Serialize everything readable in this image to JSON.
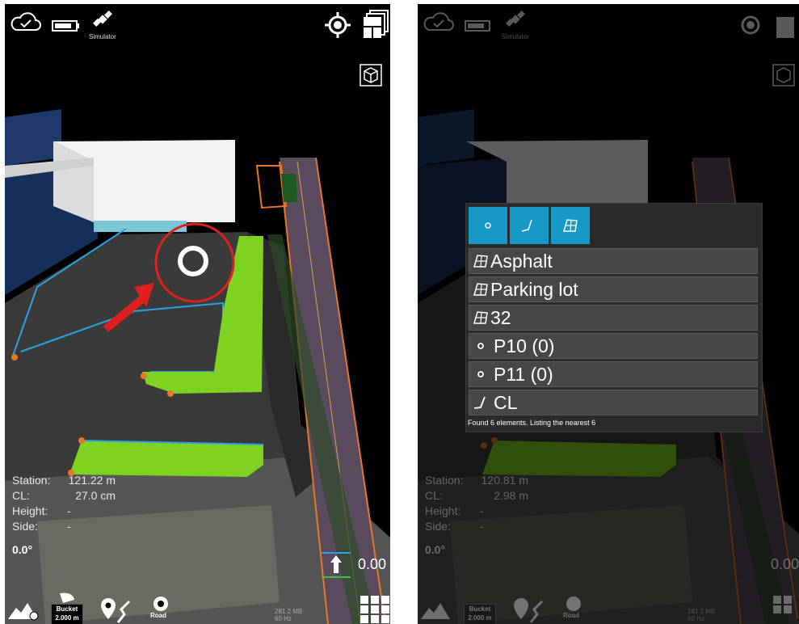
{
  "left_screen": {
    "topbar": {
      "simulator_label": "Simulator"
    },
    "info": [
      {
        "label": "Station:",
        "value": "121.22 m"
      },
      {
        "label": "CL:",
        "value": "27.0 cm"
      },
      {
        "label": "Height:",
        "value": "-"
      },
      {
        "label": "Side:",
        "value": "-"
      }
    ],
    "angle": "0.0°",
    "distance": "0.00",
    "bucket": {
      "title": "Bucket",
      "size": "2.000 m"
    },
    "road_label": "Road",
    "memory": [
      "281.2 MB",
      "60 Hz"
    ]
  },
  "right_screen": {
    "topbar": {
      "simulator_label": "Simulator"
    },
    "info": [
      {
        "label": "Station:",
        "value": "120.81 m"
      },
      {
        "label": "CL:",
        "value": "2.98 m"
      },
      {
        "label": "Height:",
        "value": "-"
      },
      {
        "label": "Side:",
        "value": "-"
      }
    ],
    "angle": "0.0°",
    "distance": "0.00",
    "bucket": {
      "title": "Bucket",
      "size": "2.000 m"
    },
    "road_label": "Road",
    "memory": [
      "281.2 MB",
      "60 Hz"
    ],
    "popup": {
      "items": [
        {
          "icon": "surface-icon",
          "label": "Asphalt"
        },
        {
          "icon": "surface-icon",
          "label": "Parking lot"
        },
        {
          "icon": "surface-icon",
          "label": "32"
        },
        {
          "icon": "point-icon",
          "label": "P10 (0)"
        },
        {
          "icon": "point-icon",
          "label": "P11 (0)"
        },
        {
          "icon": "line-icon",
          "label": "CL"
        }
      ],
      "found_text": "Found 6 elements. Listing the nearest 6"
    }
  },
  "colors": {
    "accent": "#1699c7",
    "surface_green": "#7ed321",
    "road_orange": "#e8772a",
    "line_blue": "#2aa4e0"
  }
}
